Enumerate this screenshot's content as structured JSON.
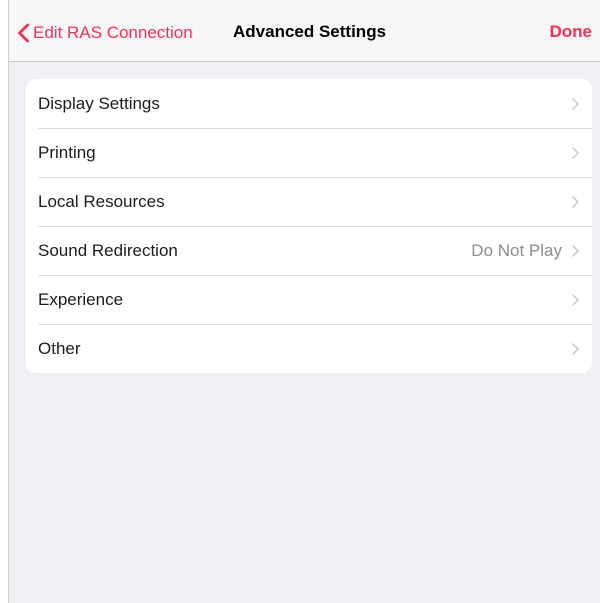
{
  "navbar": {
    "back_label": "Edit RAS Connection",
    "title": "Advanced Settings",
    "done_label": "Done"
  },
  "settings": {
    "items": [
      {
        "label": "Display Settings",
        "detail": ""
      },
      {
        "label": "Printing",
        "detail": ""
      },
      {
        "label": "Local Resources",
        "detail": ""
      },
      {
        "label": "Sound Redirection",
        "detail": "Do Not Play"
      },
      {
        "label": "Experience",
        "detail": ""
      },
      {
        "label": "Other",
        "detail": ""
      }
    ]
  },
  "icons": {
    "back": "chevron-left-icon",
    "row_disclosure": "chevron-right-icon"
  },
  "colors": {
    "accent": "#ff2d55",
    "background": "#efeff4",
    "navbar": "#f7f7f7",
    "detail_text": "#8e8e93"
  }
}
